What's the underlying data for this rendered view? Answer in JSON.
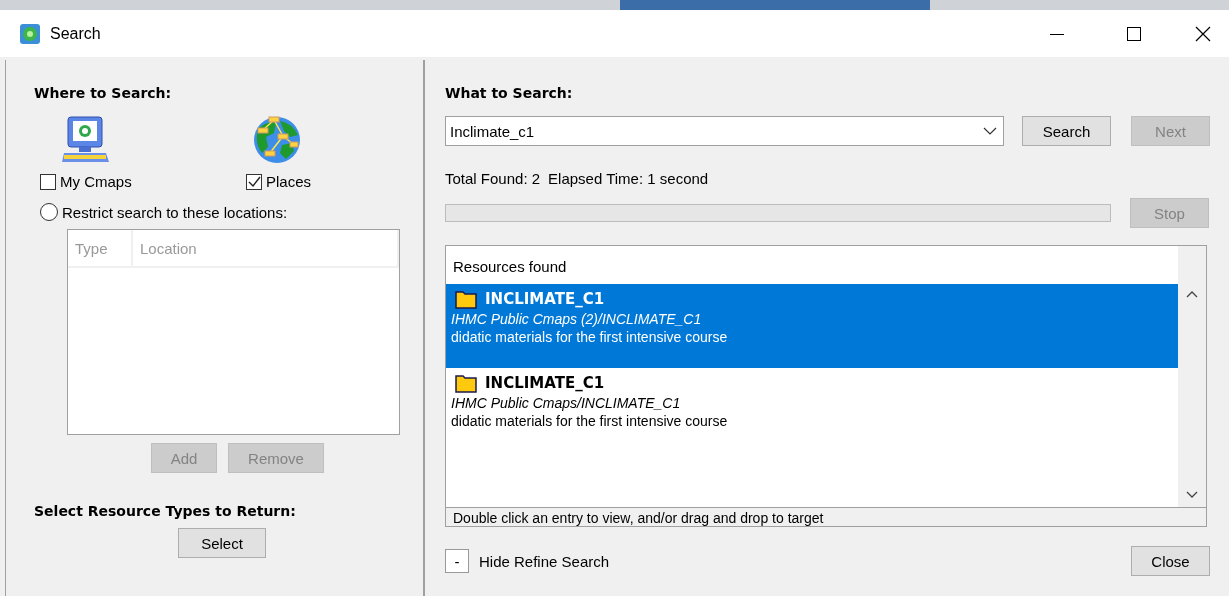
{
  "window": {
    "title": "Search"
  },
  "where": {
    "heading": "Where to Search:",
    "sources": [
      {
        "kind": "computer",
        "label": "My Cmaps",
        "checked": false
      },
      {
        "kind": "globe",
        "label": "Places",
        "checked": true
      }
    ],
    "restrict": {
      "label": "Restrict search to these locations:",
      "selected": false
    },
    "locations_table": {
      "columns": [
        "Type",
        "Location"
      ]
    },
    "buttons": [
      {
        "label": "Add",
        "disabled": true
      },
      {
        "label": "Remove",
        "disabled": true
      }
    ]
  },
  "resource_types": {
    "heading": "Select Resource Types to Return:",
    "button": {
      "label": "Select",
      "disabled": false
    }
  },
  "what": {
    "heading": "What to Search:",
    "query": "Inclimate_c1",
    "buttons": [
      {
        "label": "Search",
        "disabled": false
      },
      {
        "label": "Next",
        "disabled": true
      }
    ],
    "total_found": "Total Found: 2",
    "elapsed_time": "Elapsed Time: 1 second",
    "stop": {
      "label": "Stop",
      "disabled": true
    }
  },
  "results": {
    "header": "Resources found",
    "items": [
      {
        "title": "INCLIMATE_C1",
        "path": "IHMC Public Cmaps (2)/INCLIMATE_C1",
        "description": "didatic materials for the first intensive course",
        "selected": true
      },
      {
        "title": "INCLIMATE_C1",
        "path": "IHMC Public Cmaps/INCLIMATE_C1",
        "description": "didatic materials for the first intensive course",
        "selected": false
      }
    ],
    "hint": "Double click an entry to view, and/or drag and drop to target"
  },
  "refine": {
    "toggle": "-",
    "label": "Hide Refine Search"
  },
  "close": {
    "label": "Close",
    "disabled": false
  }
}
